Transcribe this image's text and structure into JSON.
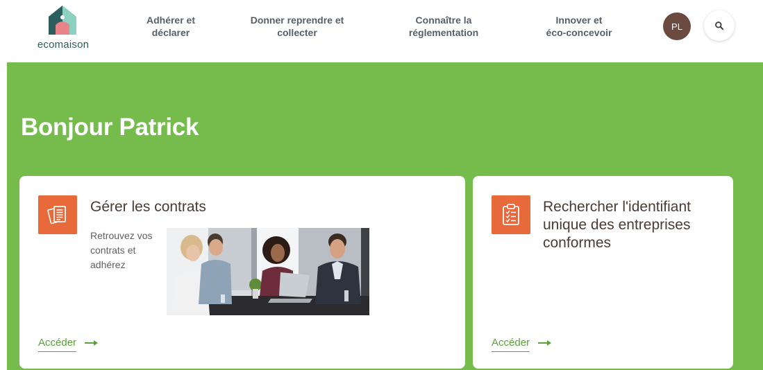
{
  "brand": {
    "name": "ecomaison",
    "color_dark": "#2c5f5d",
    "color_light": "#8cd0c0"
  },
  "nav": {
    "items": [
      {
        "line1": "Adhérer et",
        "line2": "déclarer"
      },
      {
        "line1": "Donner reprendre et",
        "line2": "collecter"
      },
      {
        "line1": "Connaître la",
        "line2": "réglementation"
      },
      {
        "line1": "Innover et",
        "line2": "éco-concevoir"
      }
    ],
    "avatar_initials": "PL",
    "search_icon": "search-icon"
  },
  "hero": {
    "greeting": "Bonjour Patrick",
    "background": "#76bc4d"
  },
  "cards": [
    {
      "title": "Gérer les contrats",
      "description": [
        "Retrouvez vos",
        "contrats et",
        "adhérez"
      ],
      "icon": "documents-icon",
      "link_label": "Accéder"
    },
    {
      "title": [
        "Rechercher l'identifiant",
        "unique des entreprises",
        "conformes"
      ],
      "icon": "clipboard-checklist-icon",
      "link_label": "Accéder"
    }
  ],
  "colors": {
    "accent_orange": "#e8693a",
    "link_green": "#5aa33a"
  }
}
